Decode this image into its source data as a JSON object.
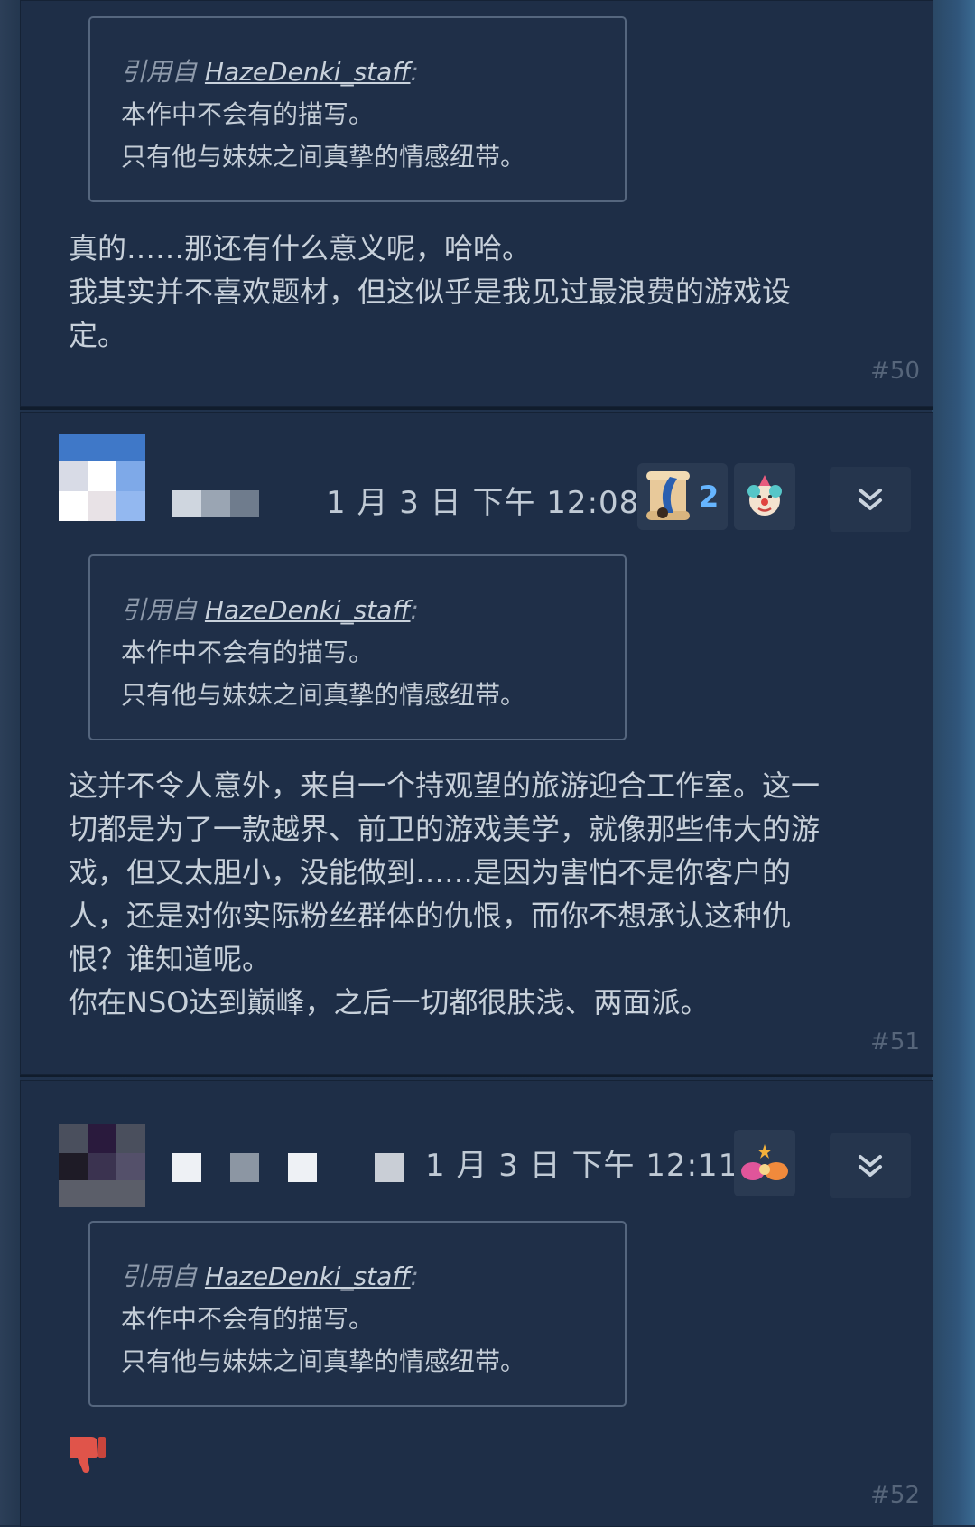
{
  "quote": {
    "prefix": "引用自",
    "author": "HazeDenki_staff",
    "colon": ":",
    "line1": "本作中不会有的描写。",
    "line2": "只有他与妹妹之间真挚的情感纽带。"
  },
  "posts": [
    {
      "number": "#50",
      "body": [
        "真的……那还有什么意义呢，哈哈。",
        "我其实并不喜欢题材，但这似乎是我见过最浪费的游戏设",
        "定。"
      ]
    },
    {
      "number": "#51",
      "timestamp": "1 月 3 日 下午 12:08",
      "award_count": "2",
      "body": [
        "这并不令人意外，来自一个持观望的旅游迎合工作室。这一",
        "切都是为了一款越界、前卫的游戏美学，就像那些伟大的游",
        "戏，但又太胆小，没能做到……是因为害怕不是你客户的",
        "人，还是对你实际粉丝群体的仇恨，而你不想承认这种仇",
        "恨？谁知道呢。",
        "你在NSO达到巅峰，之后一切都很肤浅、两面派。"
      ]
    },
    {
      "number": "#52",
      "timestamp": "1 月 3 日 下午 12:11"
    }
  ],
  "icons": {
    "menu": "double-chevron-down-icon",
    "award_1": "scroll-award-icon",
    "award_2": "clown-award-icon",
    "award_3": "clown-hands-award-icon",
    "reaction": "thumbs-down-icon"
  },
  "colors": {
    "background": "#1e2e47",
    "quote_border": "#55667e",
    "award_count": "#66b5ff",
    "thumb_down": "#e0544a"
  }
}
